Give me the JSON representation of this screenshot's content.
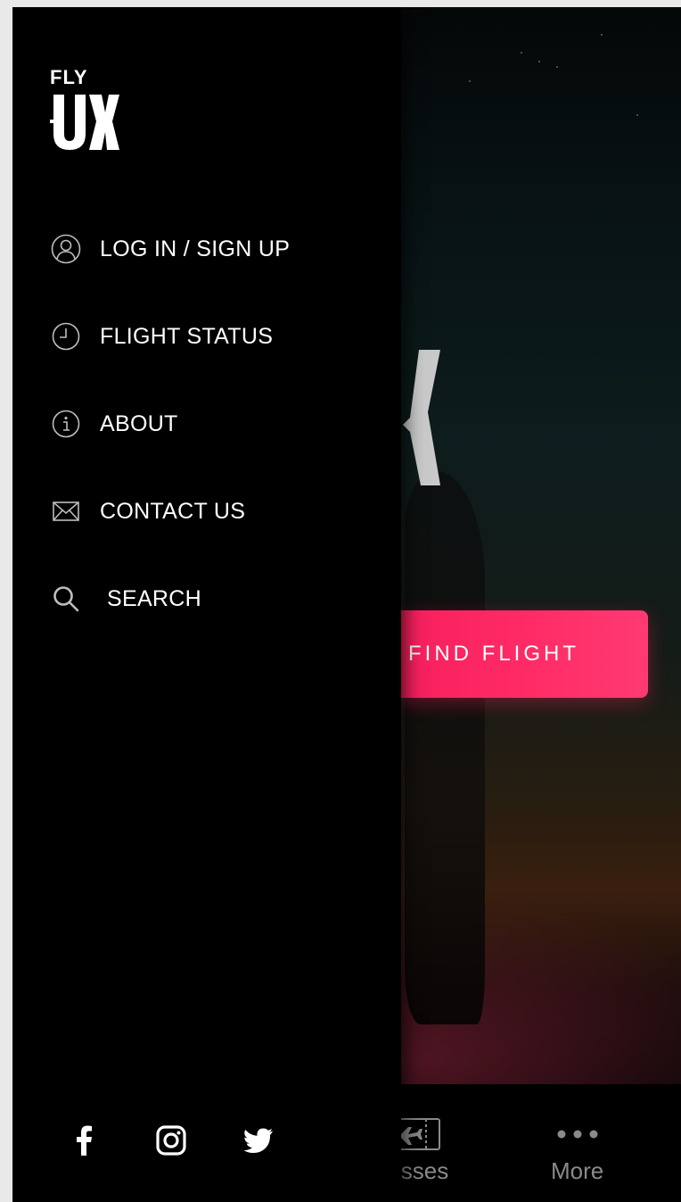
{
  "drawer": {
    "brand": {
      "top": "FLY",
      "mark": "UX"
    },
    "menu": [
      {
        "label": "LOG IN /  SIGN UP",
        "icon": "user-circle-icon"
      },
      {
        "label": "FLIGHT STATUS",
        "icon": "clock-icon"
      },
      {
        "label": "ABOUT",
        "icon": "info-icon"
      },
      {
        "label": "CONTACT US",
        "icon": "envelope-icon"
      },
      {
        "label": "SEARCH",
        "icon": "search-icon"
      }
    ],
    "social": [
      "facebook-icon",
      "instagram-icon",
      "twitter-icon"
    ]
  },
  "background": {
    "cta_label": "FIND FLIGHT",
    "tabs": [
      {
        "label": "Passes",
        "icon": "boarding-pass-icon"
      },
      {
        "label": "More",
        "icon": "more-dots-icon"
      }
    ]
  },
  "colors": {
    "accent": "#ff2b66",
    "drawer_bg": "#000000",
    "text": "#ffffff",
    "tab_text": "#8a8a8a"
  }
}
